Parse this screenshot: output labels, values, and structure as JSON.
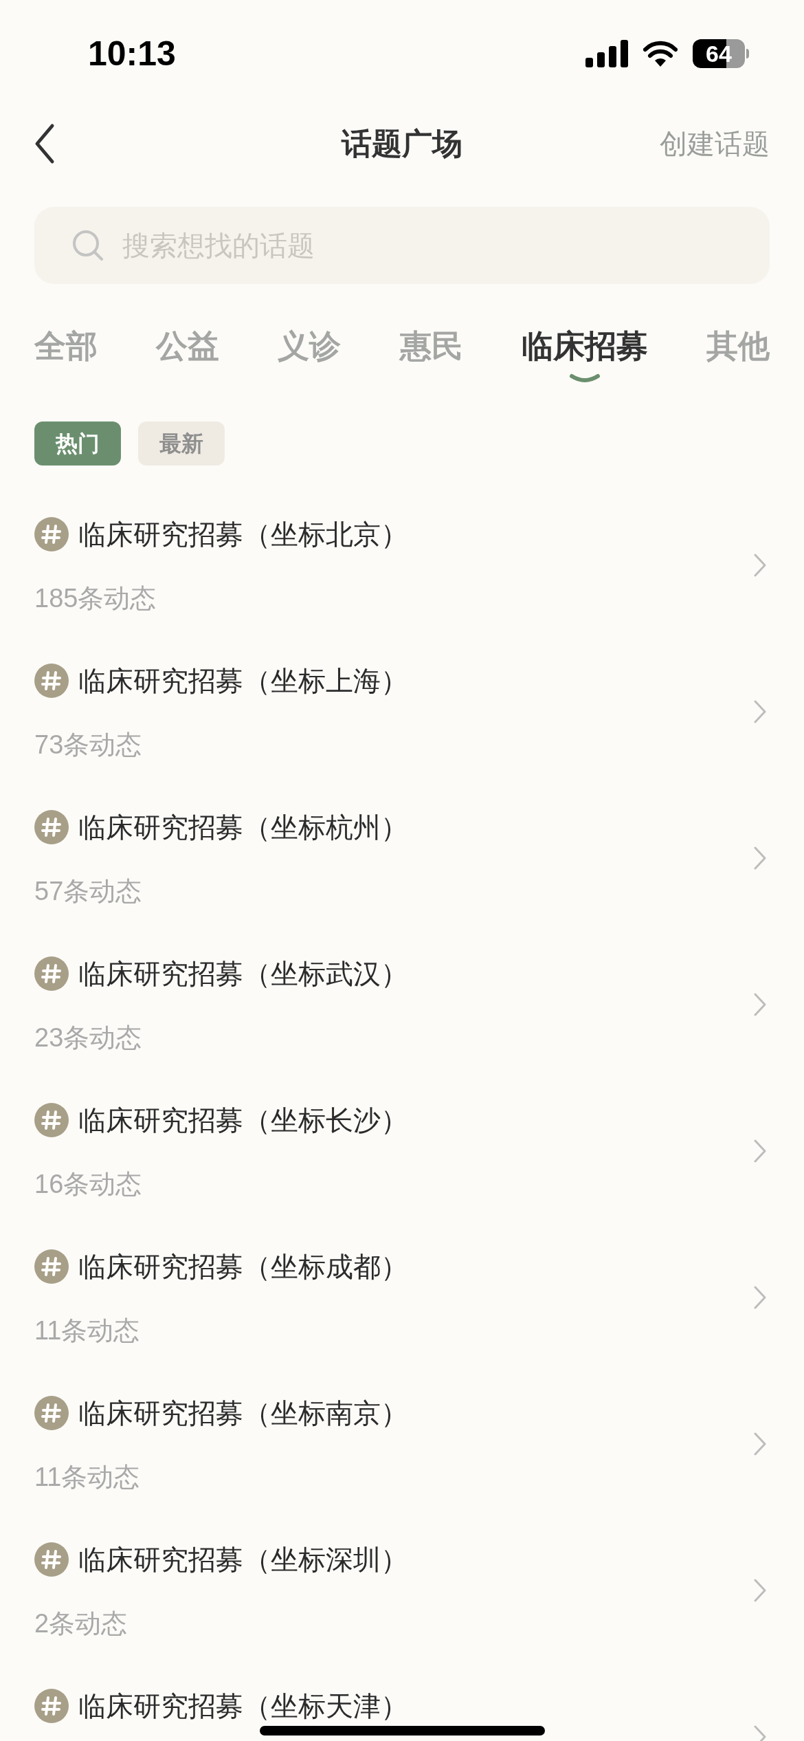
{
  "status_bar": {
    "time": "10:13",
    "battery": "64"
  },
  "nav": {
    "title": "话题广场",
    "action": "创建话题"
  },
  "search": {
    "placeholder": "搜索想找的话题"
  },
  "tabs": [
    {
      "label": "全部",
      "selected": false
    },
    {
      "label": "公益",
      "selected": false
    },
    {
      "label": "义诊",
      "selected": false
    },
    {
      "label": "惠民",
      "selected": false
    },
    {
      "label": "临床招募",
      "selected": true
    },
    {
      "label": "其他",
      "selected": false
    }
  ],
  "sort_chips": [
    {
      "label": "热门",
      "selected": true
    },
    {
      "label": "最新",
      "selected": false
    }
  ],
  "topics": [
    {
      "title": "临床研究招募（坐标北京）",
      "count": "185条动态"
    },
    {
      "title": "临床研究招募（坐标上海）",
      "count": "73条动态"
    },
    {
      "title": "临床研究招募（坐标杭州）",
      "count": "57条动态"
    },
    {
      "title": "临床研究招募（坐标武汉）",
      "count": "23条动态"
    },
    {
      "title": "临床研究招募（坐标长沙）",
      "count": "16条动态"
    },
    {
      "title": "临床研究招募（坐标成都）",
      "count": "11条动态"
    },
    {
      "title": "临床研究招募（坐标南京）",
      "count": "11条动态"
    },
    {
      "title": "临床研究招募（坐标深圳）",
      "count": "2条动态"
    },
    {
      "title": "临床研究招募（坐标天津）"
    }
  ]
}
